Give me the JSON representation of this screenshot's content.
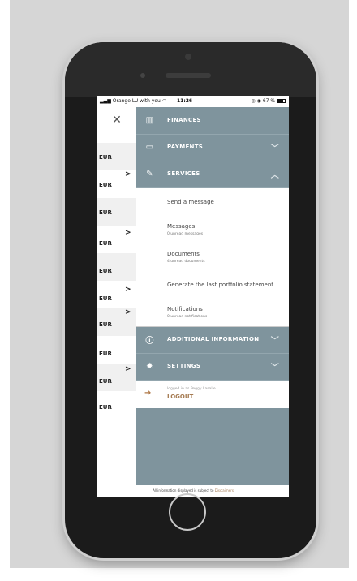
{
  "status_bar": {
    "carrier": "Orange LU with you",
    "time": "11:26",
    "battery": "67 %"
  },
  "background": {
    "close_icon": "close-icon",
    "rows": [
      {
        "currency": "EUR",
        "chevron": ">"
      },
      {
        "currency": "EUR",
        "chevron": ">"
      },
      {
        "currency": "EUR",
        "chevron": ""
      },
      {
        "currency": "EUR",
        "chevron": ">"
      },
      {
        "currency": "EUR",
        "chevron": ""
      },
      {
        "currency": "EUR",
        "chevron": ">"
      },
      {
        "currency": "EUR",
        "chevron": ">"
      },
      {
        "currency": "EUR",
        "chevron": ""
      },
      {
        "currency": "EUR",
        "chevron": ">"
      },
      {
        "currency": "EUR",
        "chevron": ""
      }
    ]
  },
  "menu": {
    "finances": "FINANCES",
    "payments": "PAYMENTS",
    "services": "SERVICES",
    "send_message": "Send a message",
    "messages": {
      "title": "Messages",
      "subtitle": "0 unread messages"
    },
    "documents": {
      "title": "Documents",
      "subtitle": "4 unread documents"
    },
    "portfolio": "Generate the last portfolio statement",
    "notifications": {
      "title": "Notifications",
      "subtitle": "0 unread notifications"
    },
    "additional_info": "ADDITIONAL INFORMATION",
    "settings": "SETTINGS",
    "logged_in": "logged in as Peggy Lasalle",
    "logout": "LOGOUT"
  },
  "footer": {
    "text": "All information displayed is subject to",
    "link": "Disclaimers"
  },
  "colors": {
    "menu_bg": "#7f949d",
    "accent": "#a57b52"
  }
}
